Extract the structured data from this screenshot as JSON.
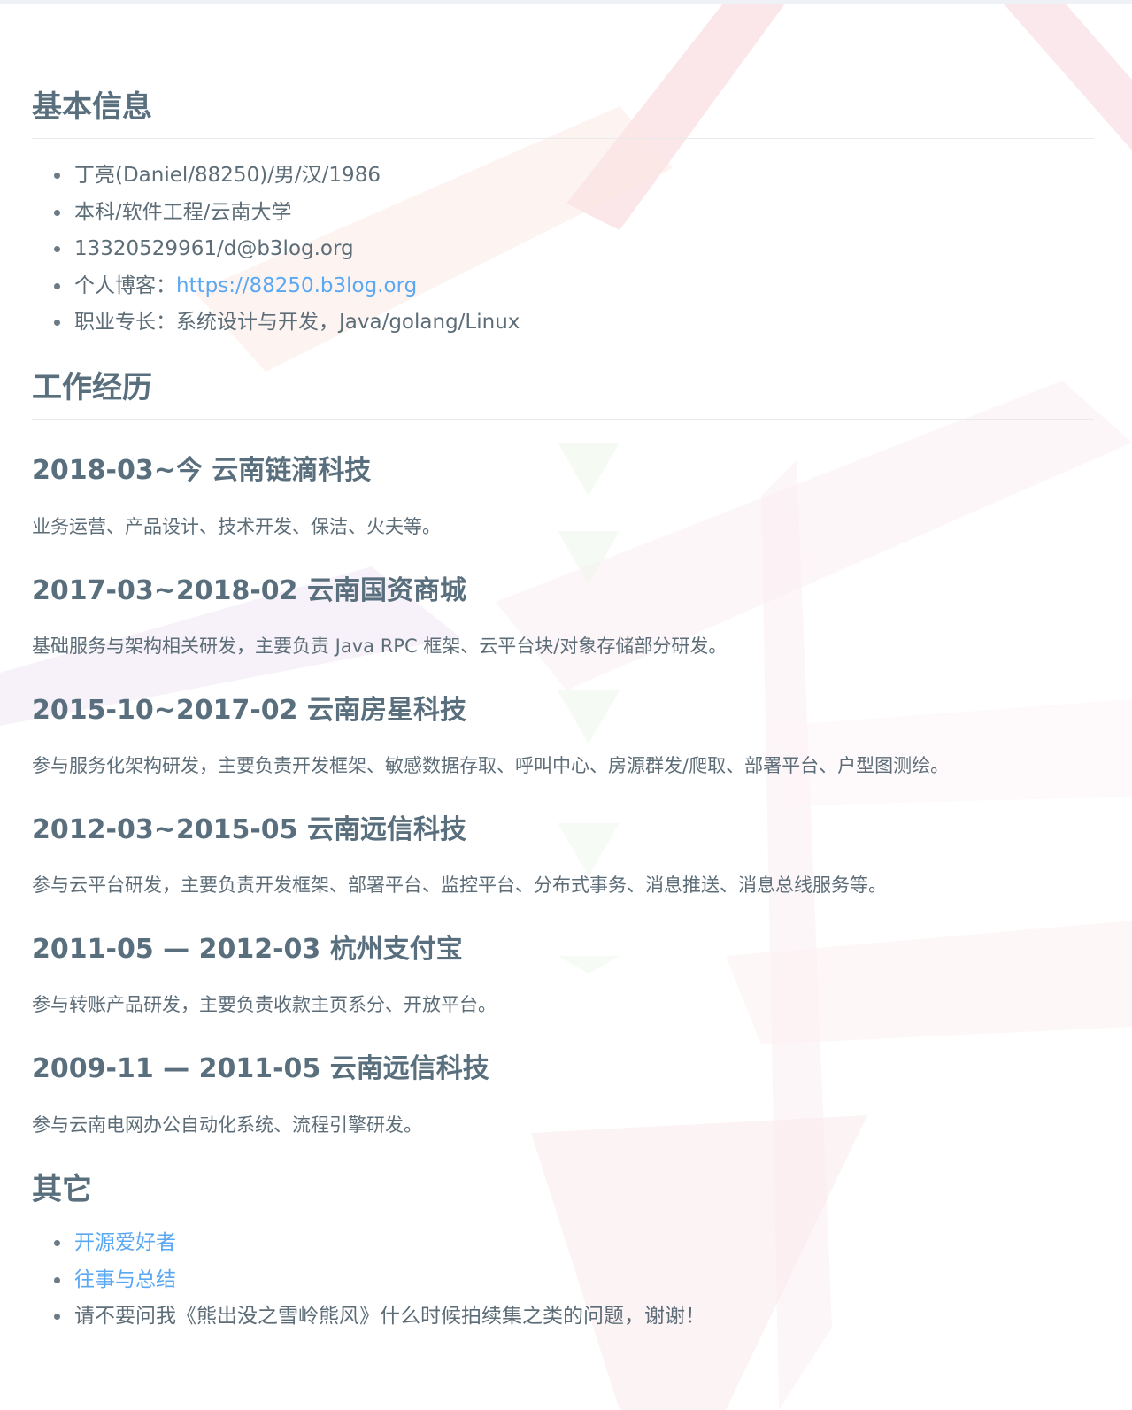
{
  "sections": {
    "basic": {
      "title": "基本信息",
      "items": [
        "丁亮(Daniel/88250)/男/汉/1986",
        "本科/软件工程/云南大学",
        "13320529961/d@b3log.org"
      ],
      "blog_label": "个人博客：",
      "blog_link": "https://88250.b3log.org",
      "expertise": "职业专长：系统设计与开发，Java/golang/Linux"
    },
    "work": {
      "title": "工作经历",
      "jobs": [
        {
          "title": "2018-03~今 云南链滴科技",
          "desc": "业务运营、产品设计、技术开发、保洁、火夫等。"
        },
        {
          "title": "2017-03~2018-02 云南国资商城",
          "desc": "基础服务与架构相关研发，主要负责 Java RPC 框架、云平台块/对象存储部分研发。"
        },
        {
          "title": "2015-10~2017-02 云南房星科技",
          "desc": "参与服务化架构研发，主要负责开发框架、敏感数据存取、呼叫中心、房源群发/爬取、部署平台、户型图测绘。"
        },
        {
          "title": "2012-03~2015-05 云南远信科技",
          "desc": "参与云平台研发，主要负责开发框架、部署平台、监控平台、分布式事务、消息推送、消息总线服务等。"
        },
        {
          "title": "2011-05 — 2012-03 杭州支付宝",
          "desc": "参与转账产品研发，主要负责收款主页系分、开放平台。"
        },
        {
          "title": "2009-11 — 2011-05 云南远信科技",
          "desc": "参与云南电网办公自动化系统、流程引擎研发。"
        }
      ]
    },
    "other": {
      "title": "其它",
      "link1": "开源爱好者",
      "link2": "往事与总结",
      "text": "请不要问我《熊出没之雪岭熊风》什么时候拍续集之类的问题，谢谢！"
    }
  },
  "colors": {
    "heading": "#596f7e",
    "text": "#5d6d78",
    "link": "#5aa7f2"
  }
}
